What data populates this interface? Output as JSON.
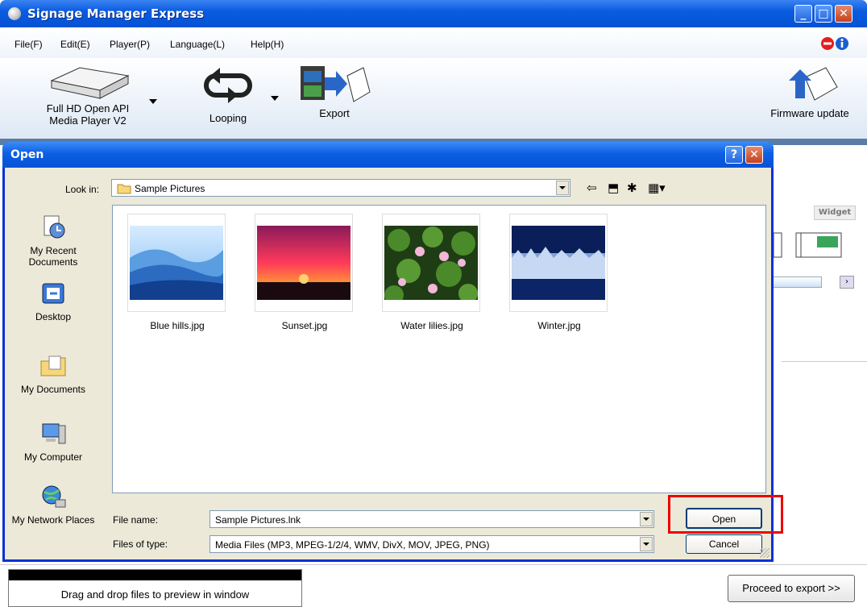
{
  "app": {
    "title": "Signage Manager Express",
    "menu": [
      "File(F)",
      "Edit(E)",
      "Player(P)",
      "Language(L)",
      "Help(H)"
    ],
    "window_buttons": [
      "minimize-icon",
      "maximize-icon",
      "close-icon"
    ],
    "toolbar": {
      "player_line1": "Full HD Open API",
      "player_line2": "Media Player V2",
      "looping": "Looping",
      "export": "Export",
      "firmware": "Firmware update"
    },
    "widget_label": "Widget",
    "status": {
      "drag_hint": "Drag and drop files to preview in window",
      "proceed": "Proceed to export >>"
    }
  },
  "dialog": {
    "title": "Open",
    "look_in_label": "Look in:",
    "look_in_value": "Sample Pictures",
    "places": [
      {
        "label": "My Recent Documents",
        "icon": "recent-documents-icon"
      },
      {
        "label": "Desktop",
        "icon": "desktop-icon"
      },
      {
        "label": "My Documents",
        "icon": "my-documents-icon"
      },
      {
        "label": "My Computer",
        "icon": "my-computer-icon"
      },
      {
        "label": "My Network Places",
        "icon": "network-places-icon"
      }
    ],
    "files": [
      {
        "name": "Blue hills.jpg"
      },
      {
        "name": "Sunset.jpg"
      },
      {
        "name": "Water lilies.jpg"
      },
      {
        "name": "Winter.jpg"
      }
    ],
    "file_name_label": "File name:",
    "file_name_value": "Sample Pictures.lnk",
    "file_type_label": "Files of type:",
    "file_type_value": "Media Files (MP3, MPEG-1/2/4, WMV, DivX, MOV, JPEG, PNG)",
    "open_button": "Open",
    "cancel_button": "Cancel",
    "highlight_color": "#e00000"
  }
}
